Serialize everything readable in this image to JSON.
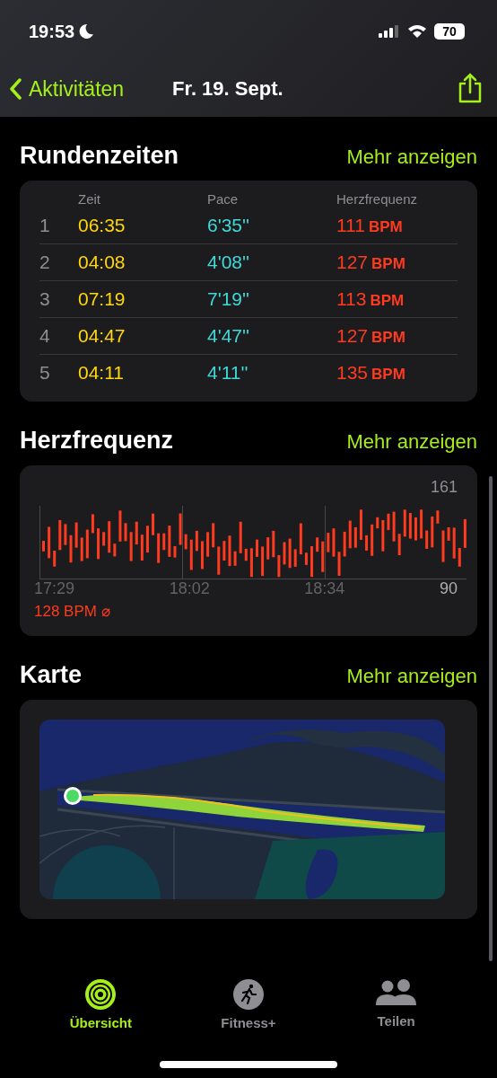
{
  "status_bar": {
    "time": "19:53",
    "battery": "70"
  },
  "nav": {
    "back": "Aktivitäten",
    "title": "Fr. 19. Sept."
  },
  "laps": {
    "title": "Rundenzeiten",
    "more": "Mehr anzeigen",
    "columns": [
      "Zeit",
      "Pace",
      "Herzfrequenz"
    ],
    "rows": [
      {
        "index": "1",
        "time": "06:35",
        "pace": "6'35''",
        "heart_rate": "111",
        "unit": "BPM"
      },
      {
        "index": "2",
        "time": "04:08",
        "pace": "4'08''",
        "heart_rate": "127",
        "unit": "BPM"
      },
      {
        "index": "3",
        "time": "07:19",
        "pace": "7'19''",
        "heart_rate": "113",
        "unit": "BPM"
      },
      {
        "index": "4",
        "time": "04:47",
        "pace": "4'47''",
        "heart_rate": "127",
        "unit": "BPM"
      },
      {
        "index": "5",
        "time": "04:11",
        "pace": "4'11''",
        "heart_rate": "135",
        "unit": "BPM"
      }
    ]
  },
  "heart_rate": {
    "title": "Herzfrequenz",
    "more": "Mehr anzeigen",
    "max_label": "161",
    "min_label": "90",
    "time_labels": [
      "17:29",
      "18:02",
      "18:34"
    ],
    "average": "128 BPM ⌀"
  },
  "map": {
    "title": "Karte",
    "more": "Mehr anzeigen",
    "kind": "picture"
  },
  "tabs": [
    {
      "label": "Übersicht",
      "kind": "rings",
      "selected": true
    },
    {
      "label": "Fitness+",
      "kind": "runner",
      "selected": false
    },
    {
      "label": "Teilen",
      "kind": "people",
      "selected": false
    }
  ]
}
